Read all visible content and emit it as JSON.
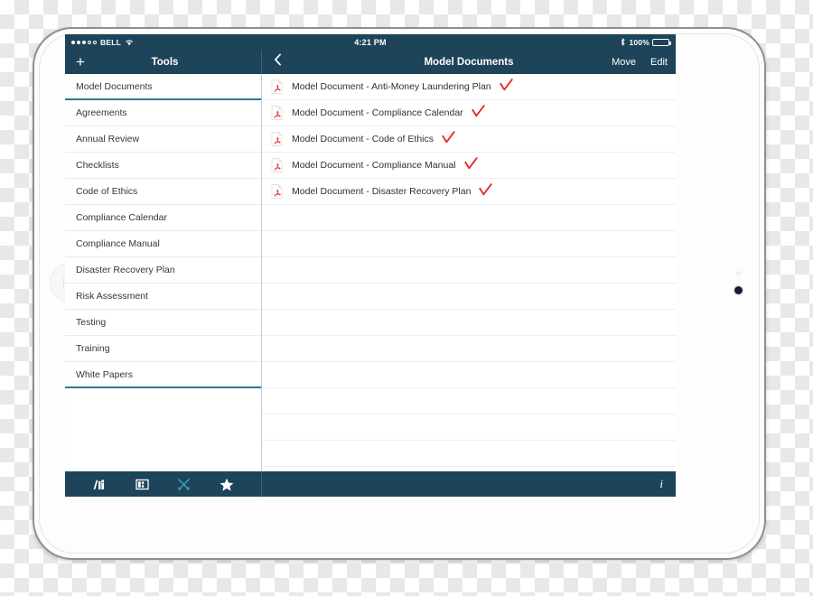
{
  "status_bar": {
    "carrier": "BELL",
    "signal_filled": 3,
    "signal_total": 5,
    "wifi_icon": "wifi-icon",
    "time": "4:21 PM",
    "bluetooth_icon": "bluetooth-icon",
    "battery_percent": "100%",
    "battery_level": 100
  },
  "nav": {
    "add_label": "+",
    "left_title": "Tools",
    "back_icon": "chevron-left-icon",
    "right_title": "Model Documents",
    "move_label": "Move",
    "edit_label": "Edit"
  },
  "sidebar": {
    "items": [
      {
        "label": "Model Documents",
        "selected": true
      },
      {
        "label": "Agreements",
        "selected": false
      },
      {
        "label": "Annual Review",
        "selected": false
      },
      {
        "label": "Checklists",
        "selected": false
      },
      {
        "label": "Code of Ethics",
        "selected": false
      },
      {
        "label": "Compliance Calendar",
        "selected": false
      },
      {
        "label": "Compliance Manual",
        "selected": false
      },
      {
        "label": "Disaster Recovery Plan",
        "selected": false
      },
      {
        "label": "Risk Assessment",
        "selected": false
      },
      {
        "label": "Testing",
        "selected": false
      },
      {
        "label": "Training",
        "selected": false
      },
      {
        "label": "White Papers",
        "selected": false
      }
    ]
  },
  "documents": {
    "rows": [
      {
        "label": "Model Document - Anti-Money Laundering Plan",
        "icon": "pdf-icon",
        "checked": true
      },
      {
        "label": "Model Document - Compliance Calendar",
        "icon": "pdf-icon",
        "checked": true
      },
      {
        "label": "Model Document - Code of Ethics",
        "icon": "pdf-icon",
        "checked": true
      },
      {
        "label": "Model Document - Compliance Manual",
        "icon": "pdf-icon",
        "checked": true
      },
      {
        "label": "Model Document - Disaster Recovery Plan",
        "icon": "pdf-icon",
        "checked": true
      }
    ],
    "empty_row_count": 10
  },
  "toolbar": {
    "items": [
      {
        "icon": "books-icon",
        "active": false
      },
      {
        "icon": "library-grid-icon",
        "active": false
      },
      {
        "icon": "tools-icon",
        "active": true
      },
      {
        "icon": "star-icon",
        "active": false
      }
    ],
    "info_label": "i",
    "info_icon": "info-icon"
  },
  "colors": {
    "chrome": "#1d4459",
    "accent_teal": "#2f7799",
    "pdf_red": "#e2302f",
    "check_red": "#e12b2b",
    "active_icon": "#3d8fb0"
  }
}
